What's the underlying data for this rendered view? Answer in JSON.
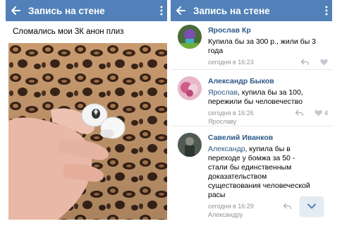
{
  "left": {
    "header": {
      "title": "Запись на стене"
    },
    "post": {
      "text": "Сломались мои 3К анон плиз"
    }
  },
  "right": {
    "header": {
      "title": "Запись на стене"
    },
    "comments": [
      {
        "author": "Ярослав Кр",
        "reply_to": "",
        "text": "Купила бы за 300 р., жили бы 3 года",
        "date": "сегодня в 16:23",
        "likes": "",
        "sub": ""
      },
      {
        "author": "Александр Быков",
        "reply_to": "Ярослав",
        "text": ", купила бы за 100, пережили бы человечество",
        "date": "сегодня в 16:26",
        "likes": "4",
        "sub": "Ярославу"
      },
      {
        "author": "Савелий Иванков",
        "reply_to": "Александр",
        "text": ", купила бы в переходе у бомжа за 50 - стали бы единственным доказательством существования человеческой расы",
        "date": "сегодня в 16:29",
        "likes": "",
        "sub": "Александру"
      }
    ]
  },
  "colors": {
    "header": "#5181b8",
    "link": "#2a5885",
    "meta": "#939393"
  },
  "icons": [
    "back-arrow-icon",
    "more-vertical-icon",
    "reply-icon",
    "heart-icon",
    "chevron-down-icon"
  ]
}
